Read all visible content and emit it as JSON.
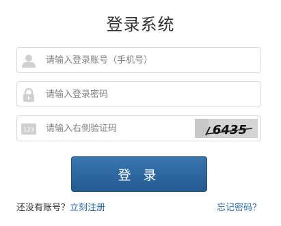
{
  "title": "登录系统",
  "form": {
    "account_placeholder": "请输入登录账号（手机号）",
    "password_placeholder": "请输入登录密码",
    "captcha_placeholder": "请输入右侧验证码",
    "captcha_text": "6435",
    "login_label": "登 录"
  },
  "footer": {
    "no_account_text": "还没有账号？",
    "register_link": "立刻注册",
    "forgot_link": "忘记密码？"
  },
  "colors": {
    "button": "#2b6399",
    "link": "#2a6cb3",
    "icon": "#cccccc"
  },
  "icons": {
    "account": "user-icon",
    "password": "lock-icon",
    "captcha": "number-123-icon"
  }
}
